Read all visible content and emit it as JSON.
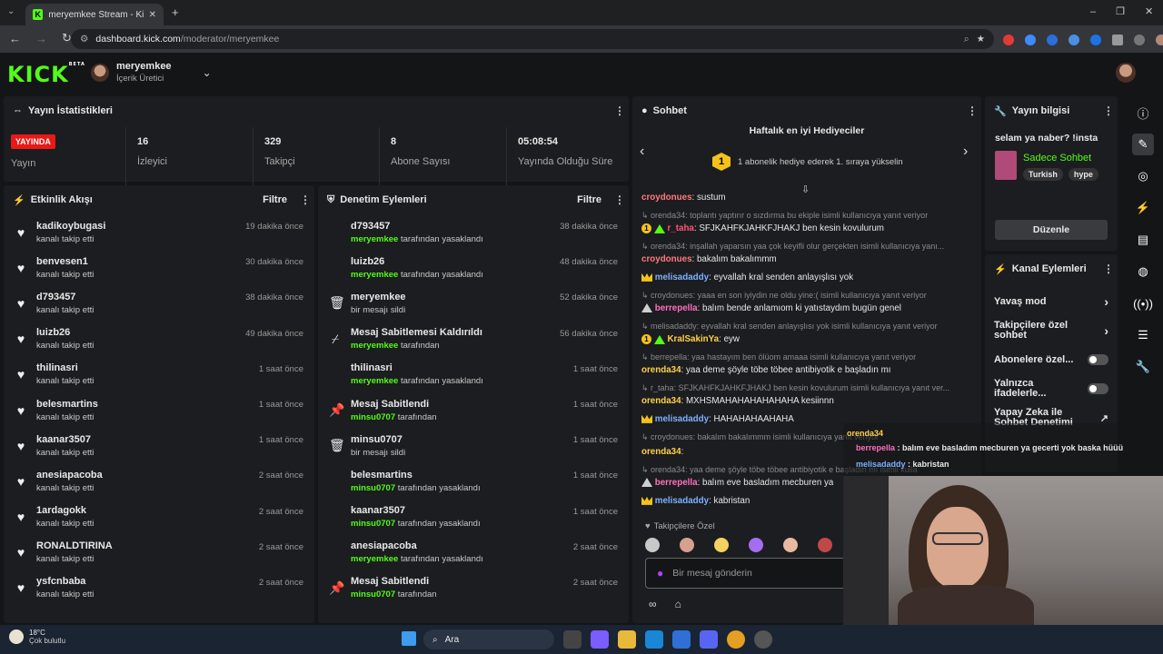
{
  "browser": {
    "tab_title": "meryemkee Stream - Kick Dashb",
    "url_host": "dashboard.kick.com",
    "url_path": "/moderator/meryemkee"
  },
  "header": {
    "logo": "KICK",
    "beta": "BETA",
    "username": "meryemkee",
    "role": "İçerik Üretici"
  },
  "stats": {
    "title": "Yayın İstatistikleri",
    "live_badge": "YAYINDA",
    "live_label": "Yayın",
    "items": [
      {
        "value": "16",
        "label": "İzleyici"
      },
      {
        "value": "329",
        "label": "Takipçi"
      },
      {
        "value": "8",
        "label": "Abone Sayısı"
      },
      {
        "value": "05:08:54",
        "label": "Yayında Olduğu Süre"
      }
    ]
  },
  "activity": {
    "title": "Etkinlik Akışı",
    "filter": "Filtre",
    "items": [
      {
        "name": "kadikoybugasi",
        "sub": "kanalı takip etti",
        "time": "19 dakika önce"
      },
      {
        "name": "benvesen1",
        "sub": "kanalı takip etti",
        "time": "30 dakika önce"
      },
      {
        "name": "d793457",
        "sub": "kanalı takip etti",
        "time": "38 dakika önce"
      },
      {
        "name": "luizb26",
        "sub": "kanalı takip etti",
        "time": "49 dakika önce"
      },
      {
        "name": "thilinasri",
        "sub": "kanalı takip etti",
        "time": "1 saat önce"
      },
      {
        "name": "belesmartins",
        "sub": "kanalı takip etti",
        "time": "1 saat önce"
      },
      {
        "name": "kaanar3507",
        "sub": "kanalı takip etti",
        "time": "1 saat önce"
      },
      {
        "name": "anesiapacoba",
        "sub": "kanalı takip etti",
        "time": "2 saat önce"
      },
      {
        "name": "1ardagokk",
        "sub": "kanalı takip etti",
        "time": "2 saat önce"
      },
      {
        "name": "RONALDTIRINA",
        "sub": "kanalı takip etti",
        "time": "2 saat önce"
      },
      {
        "name": "ysfcnbaba",
        "sub": "kanalı takip etti",
        "time": "2 saat önce"
      }
    ]
  },
  "moderation": {
    "title": "Denetim Eylemleri",
    "filter": "Filtre",
    "items": [
      {
        "icon": "ban",
        "name": "d793457",
        "who": "meryemkee",
        "rest": "tarafından yasaklandı",
        "time": "38 dakika önce"
      },
      {
        "icon": "ban",
        "name": "luizb26",
        "who": "meryemkee",
        "rest": "tarafından yasaklandı",
        "time": "48 dakika önce"
      },
      {
        "icon": "trash",
        "name": "meryemkee",
        "who": "",
        "rest": "bir mesajı sildi",
        "time": "52 dakika önce"
      },
      {
        "icon": "unpin",
        "name": "Mesaj Sabitlemesi Kaldırıldı",
        "who": "meryemkee",
        "rest": "tarafından",
        "time": "56 dakika önce"
      },
      {
        "icon": "ban",
        "name": "thilinasri",
        "who": "meryemkee",
        "rest": "tarafından yasaklandı",
        "time": "1 saat önce"
      },
      {
        "icon": "pin",
        "name": "Mesaj Sabitlendi",
        "who": "minsu0707",
        "rest": "tarafından",
        "time": "1 saat önce"
      },
      {
        "icon": "trash",
        "name": "minsu0707",
        "who": "",
        "rest": "bir mesajı sildi",
        "time": "1 saat önce"
      },
      {
        "icon": "ban",
        "name": "belesmartins",
        "who": "minsu0707",
        "rest": "tarafından yasaklandı",
        "time": "1 saat önce"
      },
      {
        "icon": "ban",
        "name": "kaanar3507",
        "who": "minsu0707",
        "rest": "tarafından yasaklandı",
        "time": "1 saat önce"
      },
      {
        "icon": "ban",
        "name": "anesiapacoba",
        "who": "meryemkee",
        "rest": "tarafından yasaklandı",
        "time": "2 saat önce"
      },
      {
        "icon": "pin",
        "name": "Mesaj Sabitlendi",
        "who": "minsu0707",
        "rest": "tarafından",
        "time": "2 saat önce"
      }
    ]
  },
  "chat": {
    "title": "Sohbet",
    "gifters_title": "Haftalık en iyi Hediyeciler",
    "gifters_sub": "1 abonelik hediye ederek 1. sıraya yükselin",
    "rank": "1",
    "followers_only": "Takipçilere Özel",
    "placeholder": "Bir mesaj gönderin",
    "messages": [
      {
        "user": "croydonues",
        "color": "#ff7a7a",
        "text": "sustum"
      },
      {
        "reply": "orenda34: toplantı yaptırır o sızdırma bu ekiple isimli kullanıcıya yanıt veriyor"
      },
      {
        "user": "r_taha",
        "color": "#ff5577",
        "text": "SFJKAHFKJAHKFJHAKJ ben kesin kovulurum"
      },
      {
        "reply": "orenda34: inşallah yaparsın yaa çok keyifli olur gerçekten isimli kullanıcıya yanı..."
      },
      {
        "user": "croydonues",
        "color": "#ff7a7a",
        "text": "bakalım bakalımmm"
      },
      {
        "user": "melisadaddy",
        "color": "#7fb0ff",
        "text": "eyvallah kral senden anlayışlısı yok"
      },
      {
        "reply": "croydonues: yaaa en son iyiydin ne oldu yine:( isimli kullanıcıya yanıt veriyor"
      },
      {
        "user": "berrepella",
        "color": "#ff70c0",
        "text": "balım bende anlamıom ki yatıstaydım bugün genel"
      },
      {
        "reply": "melisadaddy: eyvallah kral senden anlayışlısı yok isimli kullanıcıya yanıt veriyor"
      },
      {
        "user": "KralSakinYa",
        "color": "#ffd24a",
        "text": "eyw"
      },
      {
        "reply": "berrepella: yaa hastayım ben ölüom amaaa isimli kullanıcıya yanıt veriyor"
      },
      {
        "user": "orenda34",
        "color": "#ffd24a",
        "text": "yaa deme şöyle töbe töbee antibiyotik e başladın mı"
      },
      {
        "reply": "r_taha: SFJKAHFKJAHKFJHAKJ ben kesin kovulurum isimli kullanıcıya yanıt ver..."
      },
      {
        "user": "orenda34",
        "color": "#ffd24a",
        "text": "MXHSMAHAHAHAHAHAHA kesiinnn"
      },
      {
        "user": "melisadaddy",
        "color": "#7fb0ff",
        "text": "HAHAHAHAAHAHA"
      },
      {
        "reply": "croydonues: bakalım bakalımmm isimli kullanıcıya yanıt veriyor"
      },
      {
        "user": "orenda34",
        "color": "#ffd24a",
        "text": ""
      },
      {
        "reply": "orenda34: yaa deme şöyle töbe töbee antibiyotik e başladın mı isimli kulla"
      },
      {
        "user": "berrepella",
        "color": "#ff70c0",
        "text": "balım eve basladım mecburen ya"
      },
      {
        "user": "melisadaddy",
        "color": "#7fb0ff",
        "text": "kabristan"
      }
    ],
    "overlay": [
      {
        "user": "orenda34",
        "text": ""
      },
      {
        "user": "berrepella",
        "text": "balım eve basladım mecburen ya gecerti yok baska hüüü"
      },
      {
        "user": "melisadaddy",
        "text": "kabristan"
      }
    ]
  },
  "stream_info": {
    "title": "Yayın bilgisi",
    "stream_title": "selam ya naber? !insta",
    "category": "Sadece Sohbet",
    "tags": [
      "Turkish",
      "hype"
    ],
    "edit": "Düzenle"
  },
  "channel_actions": {
    "title": "Kanal Eylemleri",
    "items": [
      {
        "label": "Yavaş mod",
        "type": "chevron"
      },
      {
        "label": "Takipçilere özel sohbet",
        "type": "chevron"
      },
      {
        "label": "Abonelere özel...",
        "type": "toggle"
      },
      {
        "label": "Yalnızca ifadelerle...",
        "type": "toggle"
      },
      {
        "label": "Yapay Zeka ile Sohbet Denetimi",
        "type": "external"
      }
    ]
  },
  "taskbar": {
    "temp": "18°C",
    "weather": "Çok bulutlu",
    "search": "Ara"
  },
  "colors": {
    "accent": "#53fc18",
    "live": "#e91916",
    "panel": "#1c1d20"
  }
}
